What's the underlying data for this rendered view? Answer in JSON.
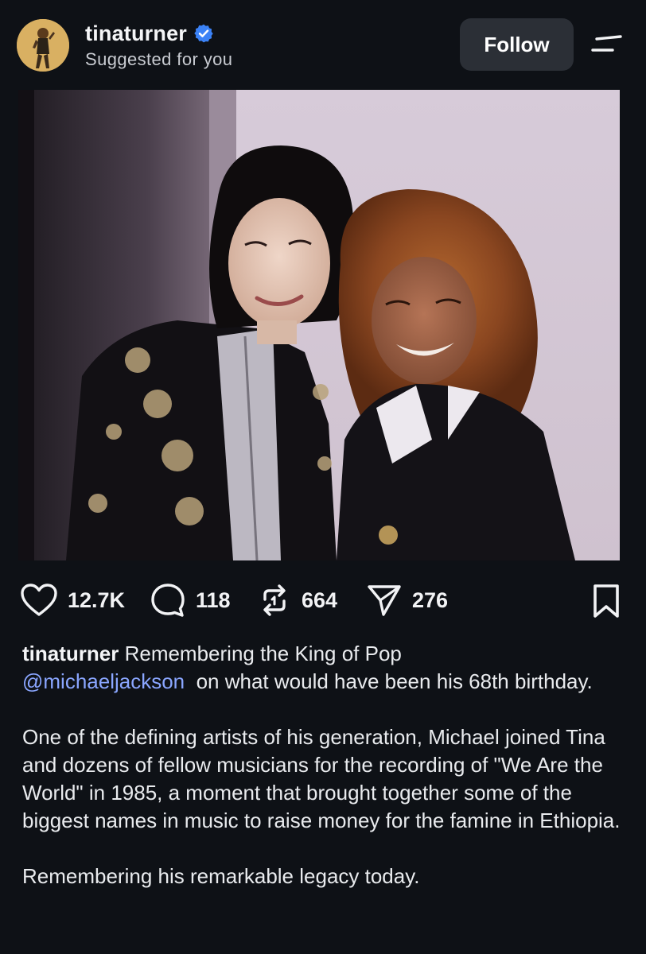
{
  "post": {
    "username": "tinaturner",
    "verified": true,
    "subtitle": "Suggested for you",
    "follow_label": "Follow"
  },
  "photo": {
    "description_icon": "photo-tina-turner-michael-jackson"
  },
  "actions": {
    "likes": "12.7K",
    "comments": "118",
    "reposts": "664",
    "shares": "276"
  },
  "caption": {
    "username": "tinaturner",
    "line1_text": "Remembering the King of Pop",
    "mention": "@michaeljackson",
    "line2_text": "on what would have been his 68th birthday.",
    "paragraph2": "One of the defining artists of his generation, Michael joined Tina and dozens of fellow musicians for the recording of \"We Are the World\" in 1985, a moment that brought together some of the biggest names in music to raise money for the famine in Ethiopia.",
    "paragraph3": "Remembering his remarkable legacy today."
  },
  "colors": {
    "background": "#0e1116",
    "follow_button": "#2b2f36",
    "verified_badge": "#3b82f6",
    "mention": "#8aa6ff"
  }
}
